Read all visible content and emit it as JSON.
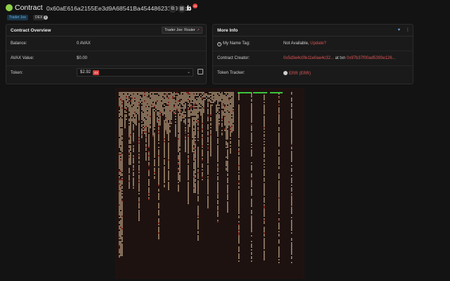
{
  "header": {
    "title": "Contract",
    "address": "0x60aE616a2155Ee3d9A68541Ba4544862310933d4",
    "copy_icon": "copy-icon",
    "qr_icon": "qr-icon",
    "b_label": "b",
    "b_badge": "25",
    "tags": {
      "trader_joe": "Trader Joe",
      "dex": "DEX"
    }
  },
  "overview": {
    "title": "Contract Overview",
    "link_label": "Trader Joe: Router",
    "rows": [
      {
        "label": "Balance:",
        "value": "0 AVAX"
      },
      {
        "label": "AVAX Value:",
        "value": "$0.00"
      },
      {
        "label": "Token:",
        "value": "$2.92",
        "badge": "43"
      }
    ]
  },
  "more_info": {
    "title": "More Info",
    "name_tag_label": "My Name Tag:",
    "name_tag_value": "Not Available,",
    "name_tag_link": "Update?",
    "creator_label": "Contract Creator:",
    "creator_addr": "0x5d3e4c0fe11e0ae4c32...",
    "creator_at": "at txn",
    "creator_txn": "0x97b37f00ad5393e126...",
    "tracker_label": "Token Tracker:",
    "tracker_value": "ERR (ERR)"
  },
  "colors": {
    "bg": "#131313",
    "card": "#1a1a1a",
    "accent_green": "#8ed14a",
    "link_red": "#e05555",
    "viz_bg": "#1e1210",
    "viz_beige": "#e8c9a0",
    "viz_red": "#d23a2a",
    "viz_green": "#3cc43c"
  }
}
